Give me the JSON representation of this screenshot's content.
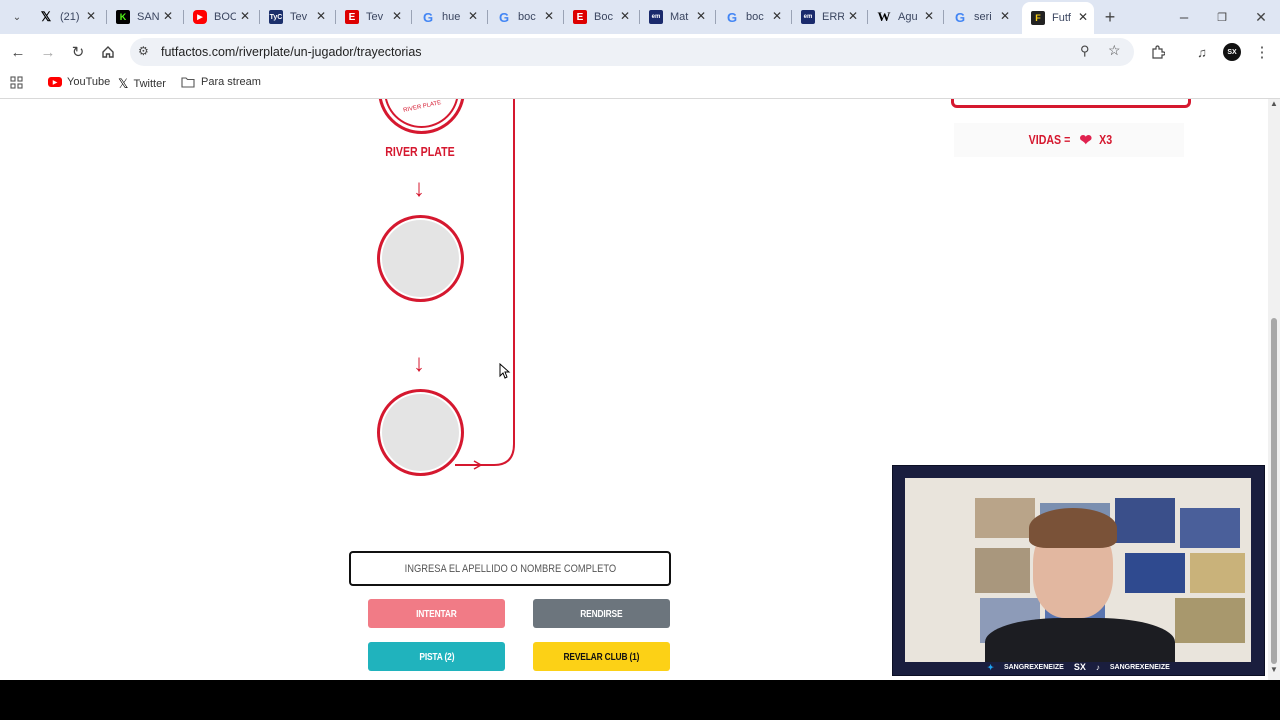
{
  "tabs": [
    {
      "label": "(21)",
      "icon": "x-logo-icon",
      "color": "#000000"
    },
    {
      "label": "SAN",
      "icon": "kick-icon",
      "color": "#53fc18"
    },
    {
      "label": "BOC",
      "icon": "youtube-icon",
      "color": "#ff0000"
    },
    {
      "label": "Tev",
      "icon": "tyc-icon",
      "color": "#1b2f6b"
    },
    {
      "label": "Tev",
      "icon": "espn-icon",
      "color": "#d00000"
    },
    {
      "label": "hue",
      "icon": "google-icon",
      "color": "#4285f4"
    },
    {
      "label": "boc",
      "icon": "google-icon",
      "color": "#4285f4"
    },
    {
      "label": "Boc",
      "icon": "espn-icon",
      "color": "#d00000"
    },
    {
      "label": "Mat",
      "icon": "site-icon",
      "color": "#1a2a6c"
    },
    {
      "label": "boc",
      "icon": "google-icon",
      "color": "#4285f4"
    },
    {
      "label": "ERR",
      "icon": "site-icon",
      "color": "#1a2a6c"
    },
    {
      "label": "Agu",
      "icon": "wikipedia-icon",
      "color": "#ffffff"
    },
    {
      "label": "seri",
      "icon": "google-icon",
      "color": "#4285f4"
    },
    {
      "label": "Futf",
      "icon": "futfactos-icon",
      "color": "#222222"
    }
  ],
  "address_bar": {
    "url": "futfactos.com/riverplate/un-jugador/trayectorias"
  },
  "profile_initials": "SX",
  "bookmarks": [
    {
      "label": "YouTube",
      "icon": "youtube-icon"
    },
    {
      "label": "Twitter",
      "icon": "x-logo-icon"
    },
    {
      "label": "Para stream",
      "icon": "folder-icon"
    }
  ],
  "game": {
    "club_label": "RIVER PLATE",
    "lives_label": "VIDAS =",
    "lives_count": "X3",
    "input_placeholder": "INGRESA EL APELLIDO O NOMBRE COMPLETO",
    "buttons": {
      "try": "INTENTAR",
      "give_up": "RENDIRSE",
      "hint": "PISTA (2)",
      "reveal": "REVELAR CLUB (1)"
    }
  },
  "colors": {
    "accent": "#d5182f",
    "try": "#f17b86",
    "give_up": "#6c757d",
    "hint": "#20b3bd",
    "reveal": "#fcd116"
  },
  "webcam_overlay": {
    "handle_1": "SANGREXENEIZE",
    "handle_2": "SANGREXENEIZE",
    "logo": "SX"
  }
}
